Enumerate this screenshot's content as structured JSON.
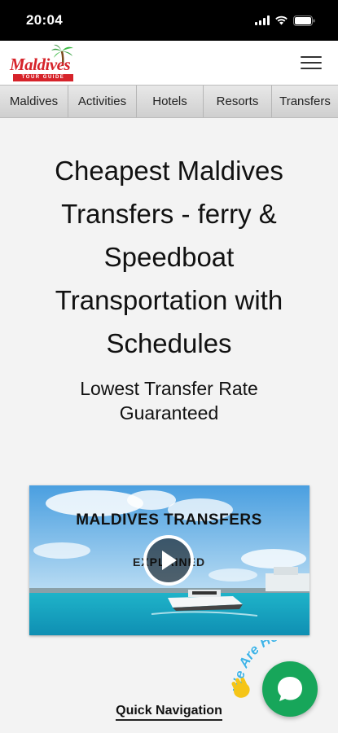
{
  "status_bar": {
    "time": "20:04"
  },
  "header": {
    "logo_text": "Maldives",
    "logo_subtext": "TOUR GUIDE"
  },
  "nav": {
    "items": [
      {
        "label": "Maldives"
      },
      {
        "label": "Activities"
      },
      {
        "label": "Hotels"
      },
      {
        "label": "Resorts"
      },
      {
        "label": "Transfers"
      }
    ]
  },
  "main": {
    "title": "Cheapest Maldives Transfers - ferry & Speedboat Transportation with Schedules",
    "subtitle": "Lowest Transfer Rate Guaranteed",
    "video": {
      "title": "MALDIVES TRANSFERS",
      "subtitle": "EXPLAINED"
    },
    "quick_nav_label": "Quick Navigation"
  },
  "chat": {
    "badge_text": "We Are Here!"
  },
  "colors": {
    "brand_red": "#d6232a",
    "chat_green": "#17a65a",
    "badge_blue": "#3fb3e6",
    "badge_yellow": "#f5c518"
  },
  "icons": [
    "hamburger-menu-icon",
    "play-icon",
    "chat-icon",
    "wave-hand-icon",
    "palm-tree-icon"
  ]
}
